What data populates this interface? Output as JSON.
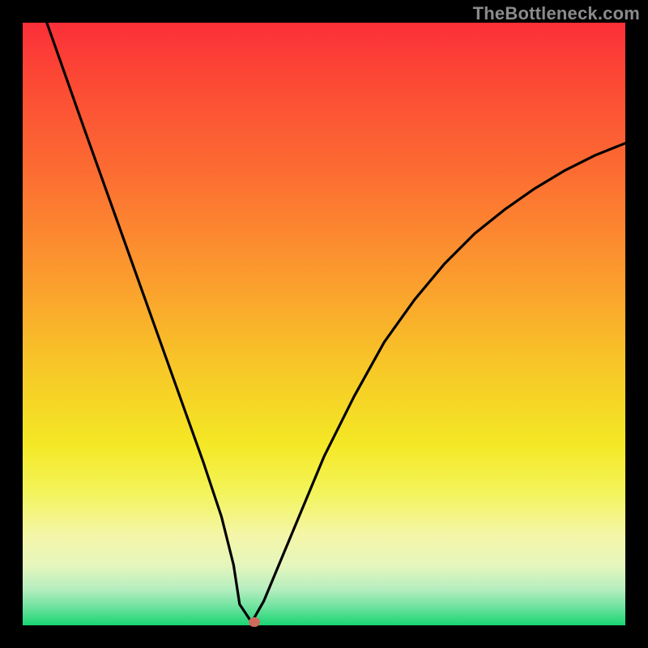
{
  "watermark": "TheBottleneck.com",
  "colors": {
    "background_frame": "#000000",
    "gradient_top": "#fb2f39",
    "gradient_bottom": "#19d572",
    "curve": "#000000",
    "marker": "#cf6b5d",
    "watermark_text": "#8b8b8b"
  },
  "chart_data": {
    "type": "line",
    "title": "",
    "xlabel": "",
    "ylabel": "",
    "xlim": [
      0,
      100
    ],
    "ylim": [
      0,
      100
    ],
    "series": [
      {
        "name": "curve",
        "x": [
          4,
          10,
          15,
          20,
          25,
          30,
          33,
          35,
          36,
          38,
          40,
          45,
          50,
          55,
          60,
          65,
          70,
          75,
          80,
          85,
          90,
          95,
          100
        ],
        "y": [
          100,
          83,
          69,
          55,
          41,
          27,
          18,
          10,
          3.5,
          0.5,
          4,
          16,
          28,
          38,
          47,
          54,
          60,
          65,
          69,
          72.5,
          75.5,
          78,
          80
        ]
      }
    ],
    "marker": {
      "x": 38.5,
      "y": 0.5
    },
    "notes": "V-shaped curve over a vertical red-to-green gradient. No axes, ticks, or labels are visible. Curve starts at top-left, descends nearly linearly to a sharp minimum near x≈38, then rises with decreasing slope toward the right edge at y≈80."
  }
}
